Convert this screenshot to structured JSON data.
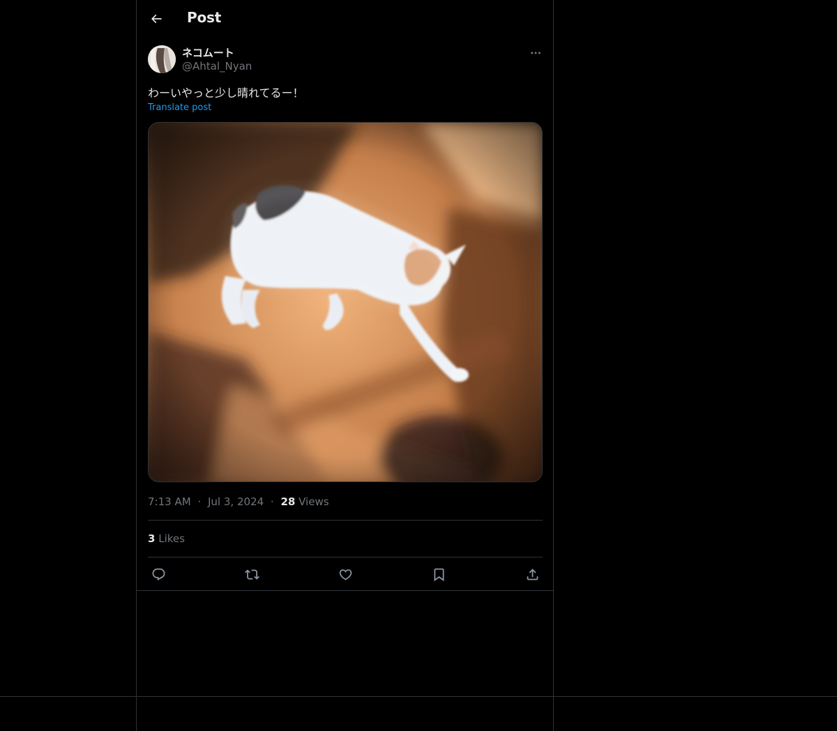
{
  "header": {
    "title": "Post",
    "back_icon": "arrow-left-icon"
  },
  "post": {
    "author": {
      "display_name": "ネコムート",
      "handle": "@Ahtal_Nyan"
    },
    "text": "わーいやっと少し晴れてるー！",
    "translate_label": "Translate post",
    "image": {
      "subject": "cat-photo"
    },
    "meta": {
      "time": "7:13 AM",
      "dot": "·",
      "date": "Jul 3, 2024",
      "views_count": "28",
      "views_label": "Views"
    },
    "likes": {
      "count": "3",
      "label": "Likes"
    },
    "actions": [
      "reply-icon",
      "repost-icon",
      "like-icon",
      "bookmark-icon",
      "share-icon"
    ]
  },
  "colors": {
    "background": "#000000",
    "border": "#2f3336",
    "text_primary": "#e7e9ea",
    "text_secondary": "#71767b",
    "link": "#1d9bf0"
  }
}
